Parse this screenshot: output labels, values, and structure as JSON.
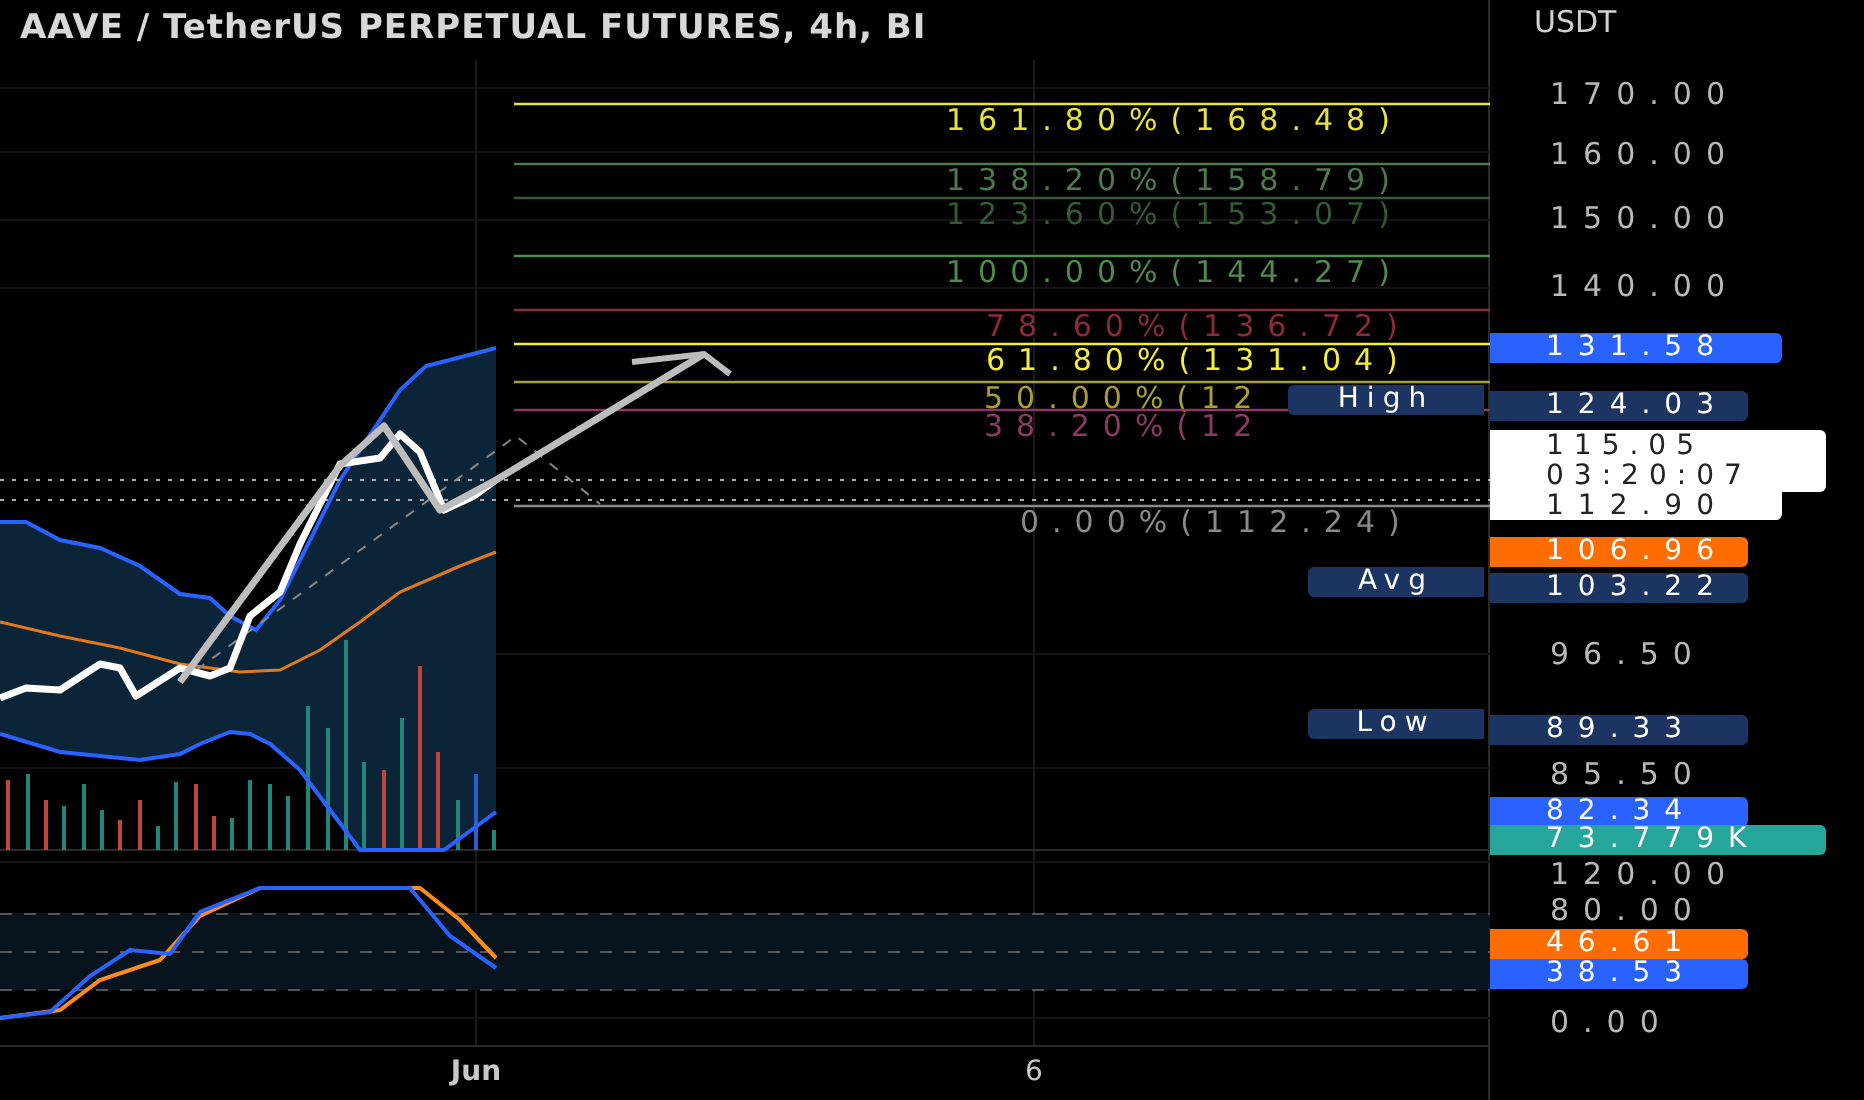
{
  "title": "AAVE / TetherUS PERPETUAL FUTURES, 4h, BI",
  "currency": "USDT",
  "fib_levels": [
    {
      "label": "161.80%(168.48)",
      "color": "#e8e43a"
    },
    {
      "label": "138.20%(158.79)",
      "color": "#4e7a4e"
    },
    {
      "label": "123.60%(153.07)",
      "color": "#355a35"
    },
    {
      "label": "100.00%(144.27)",
      "color": "#4f8a4f"
    },
    {
      "label": "78.60%(136.72)",
      "color": "#8a2a3a"
    },
    {
      "label": "61.80%(131.04)",
      "color": "#f2ee3a"
    },
    {
      "label": "50.00%(12",
      "color": "#a8a030"
    },
    {
      "label": "38.20%(12",
      "color": "#8a3a60"
    },
    {
      "label": "0.00%(112.24)",
      "color": "#8a8a8a"
    }
  ],
  "price_ticks": [
    "170.00",
    "160.00",
    "150.00",
    "140.00",
    "96.50",
    "85.50"
  ],
  "price_tags": [
    {
      "kind": "value",
      "value": "131.58",
      "color": "#2962ff"
    },
    {
      "kind": "labeled",
      "label": "High",
      "value": "124.03",
      "color": "#1c3461"
    },
    {
      "kind": "countdown",
      "value": "115.05",
      "time": "03:20:07",
      "close": "112.90"
    },
    {
      "kind": "value",
      "value": "106.96",
      "color": "#ff6d00"
    },
    {
      "kind": "labeled",
      "label": "Avg",
      "value": "103.22",
      "color": "#1c3461"
    },
    {
      "kind": "labeled",
      "label": "Low",
      "value": "89.33",
      "color": "#1c3461"
    },
    {
      "kind": "value",
      "value": "82.34",
      "color": "#2962ff"
    },
    {
      "kind": "volume",
      "value": "73.779K",
      "color": "#26a69a"
    }
  ],
  "osc_ticks": [
    "120.00",
    "80.00",
    "0.00"
  ],
  "osc_tags": [
    {
      "value": "46.61",
      "color": "#ff6d00"
    },
    {
      "value": "38.53",
      "color": "#2962ff"
    }
  ],
  "time_labels": [
    {
      "label": "Jun",
      "bold": true
    },
    {
      "label": "6",
      "bold": false
    }
  ]
}
